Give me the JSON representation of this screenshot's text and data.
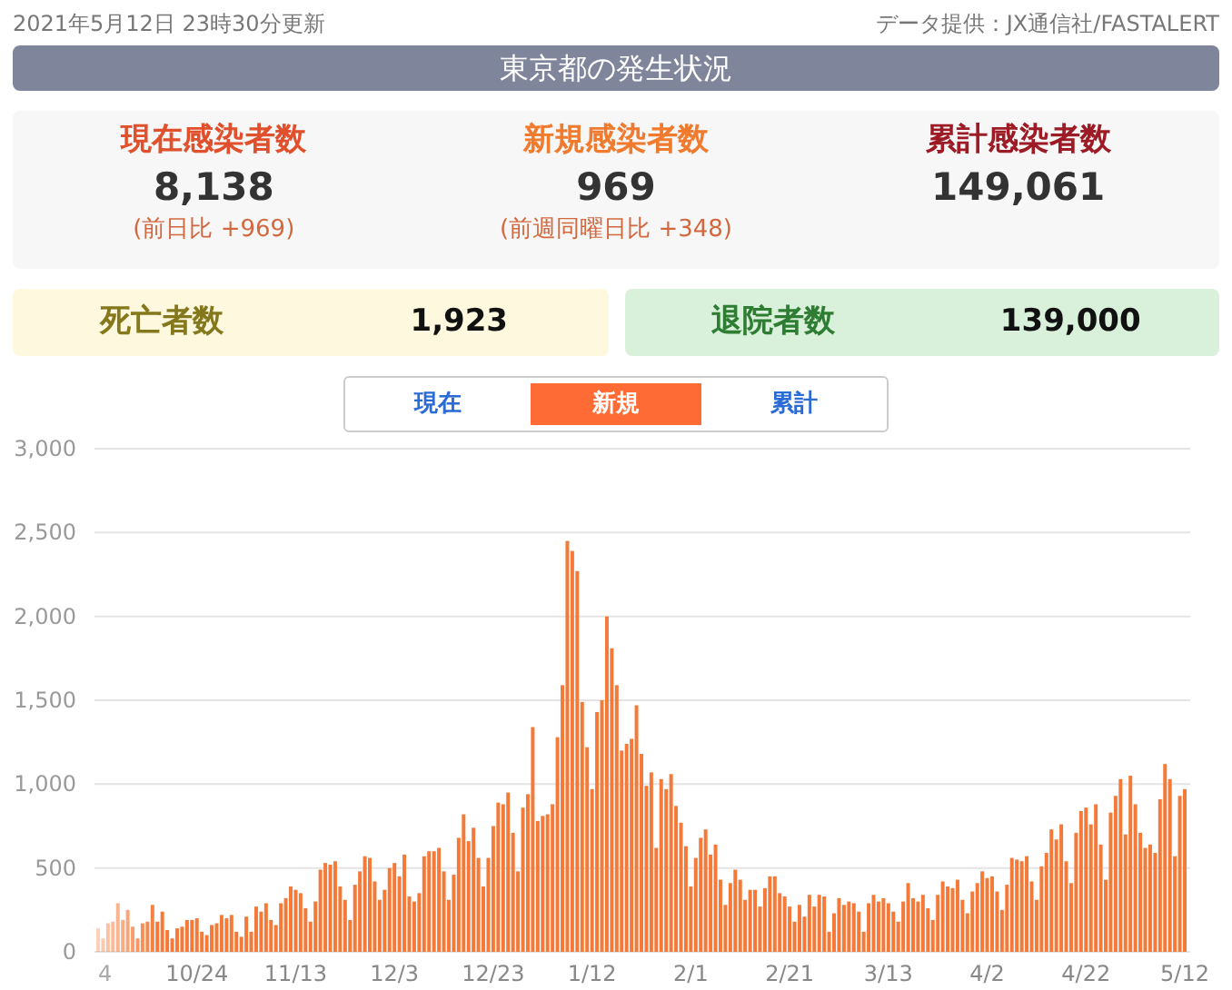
{
  "updated": "2021年5月12日 23時30分更新",
  "source": "データ提供：JX通信社/FASTALERT",
  "title": "東京都の発生状況",
  "stats": [
    {
      "label": "現在感染者数",
      "color": "#e0502c",
      "value": "8,138",
      "note": "(前日比 +969)"
    },
    {
      "label": "新規感染者数",
      "color": "#f07a2e",
      "value": "969",
      "note": "(前週同曜日比 +348)"
    },
    {
      "label": "累計感染者数",
      "color": "#9c1b24",
      "value": "149,061"
    }
  ],
  "totals": [
    {
      "kind": "deaths",
      "label": "死亡者数",
      "value": "1,923"
    },
    {
      "kind": "recovered",
      "label": "退院者数",
      "value": "139,000"
    }
  ],
  "tabs": [
    {
      "label": "現在",
      "selected": false
    },
    {
      "label": "新規",
      "selected": true
    },
    {
      "label": "累計",
      "selected": false
    }
  ],
  "chart_data": {
    "type": "bar",
    "grid": true,
    "categories": [
      "4",
      null,
      null,
      null,
      null,
      null,
      null,
      null,
      null,
      null,
      null,
      null,
      null,
      null,
      null,
      null,
      null,
      null,
      null,
      null,
      "10/24",
      null,
      null,
      null,
      null,
      null,
      null,
      null,
      null,
      null,
      null,
      null,
      null,
      null,
      null,
      null,
      null,
      null,
      null,
      null,
      "11/13",
      null,
      null,
      null,
      null,
      null,
      null,
      null,
      null,
      null,
      null,
      null,
      null,
      null,
      null,
      null,
      null,
      null,
      null,
      null,
      "12/3",
      null,
      null,
      null,
      null,
      null,
      null,
      null,
      null,
      null,
      null,
      null,
      null,
      null,
      null,
      null,
      null,
      null,
      null,
      null,
      "12/23",
      null,
      null,
      null,
      null,
      null,
      null,
      null,
      null,
      null,
      null,
      null,
      null,
      null,
      null,
      null,
      null,
      null,
      null,
      null,
      "1/12",
      null,
      null,
      null,
      null,
      null,
      null,
      null,
      null,
      null,
      null,
      null,
      null,
      null,
      null,
      null,
      null,
      null,
      null,
      null,
      "2/1",
      null,
      null,
      null,
      null,
      null,
      null,
      null,
      null,
      null,
      null,
      null,
      null,
      null,
      null,
      null,
      null,
      null,
      null,
      null,
      "2/21",
      null,
      null,
      null,
      null,
      null,
      null,
      null,
      null,
      null,
      null,
      null,
      null,
      null,
      null,
      null,
      null,
      null,
      null,
      null,
      "3/13",
      null,
      null,
      null,
      null,
      null,
      null,
      null,
      null,
      null,
      null,
      null,
      null,
      null,
      null,
      null,
      null,
      null,
      null,
      null,
      "4/2",
      null,
      null,
      null,
      null,
      null,
      null,
      null,
      null,
      null,
      null,
      null,
      null,
      null,
      null,
      null,
      null,
      null,
      null,
      null,
      "4/22",
      null,
      null,
      null,
      null,
      null,
      null,
      null,
      null,
      null,
      null,
      null,
      null,
      null,
      null,
      null,
      null,
      null,
      null,
      null,
      "5/12"
    ],
    "yticks": [
      {
        "value": 0,
        "label": "0"
      },
      {
        "value": 500,
        "label": "500"
      },
      {
        "value": 1000,
        "label": "1,000"
      },
      {
        "value": 1500,
        "label": "1,500"
      },
      {
        "value": 2000,
        "label": "2,000"
      },
      {
        "value": 2500,
        "label": "2,500"
      },
      {
        "value": 3000,
        "label": "3,000"
      }
    ],
    "ylim": [
      0,
      3000
    ],
    "series": [
      {
        "color": "#f47a3a",
        "values": [
          140,
          80,
          170,
          180,
          290,
          190,
          250,
          150,
          80,
          170,
          180,
          280,
          180,
          240,
          130,
          80,
          140,
          150,
          190,
          190,
          200,
          120,
          100,
          160,
          170,
          220,
          200,
          220,
          120,
          90,
          210,
          120,
          270,
          240,
          290,
          190,
          160,
          290,
          320,
          390,
          370,
          350,
          260,
          180,
          300,
          490,
          530,
          520,
          540,
          390,
          310,
          190,
          400,
          480,
          570,
          560,
          420,
          310,
          370,
          500,
          530,
          450,
          580,
          330,
          300,
          350,
          570,
          600,
          600,
          620,
          480,
          310,
          460,
          680,
          820,
          660,
          740,
          560,
          390,
          560,
          750,
          890,
          880,
          950,
          710,
          480,
          860,
          940,
          1340,
          780,
          810,
          820,
          880,
          1280,
          1590,
          2450,
          2390,
          2270,
          1490,
          1220,
          970,
          1430,
          1500,
          2000,
          1810,
          1590,
          1200,
          1240,
          1270,
          1470,
          1180,
          990,
          1070,
          620,
          1030,
          970,
          1060,
          870,
          770,
          630,
          390,
          560,
          680,
          730,
          580,
          640,
          430,
          280,
          410,
          490,
          430,
          310,
          370,
          370,
          270,
          380,
          450,
          450,
          350,
          330,
          270,
          180,
          280,
          210,
          340,
          270,
          340,
          330,
          120,
          230,
          320,
          280,
          300,
          290,
          240,
          120,
          290,
          340,
          300,
          320,
          290,
          240,
          180,
          300,
          410,
          320,
          300,
          340,
          260,
          190,
          340,
          420,
          390,
          380,
          430,
          310,
          230,
          360,
          410,
          480,
          440,
          450,
          360,
          250,
          400,
          560,
          550,
          540,
          570,
          420,
          310,
          510,
          590,
          730,
          670,
          760,
          540,
          410,
          710,
          840,
          860,
          760,
          880,
          640,
          430,
          830,
          930,
          1030,
          700,
          1050,
          880,
          710,
          620,
          640,
          590,
          910,
          1120,
          1030,
          570,
          930,
          970
        ]
      }
    ]
  }
}
